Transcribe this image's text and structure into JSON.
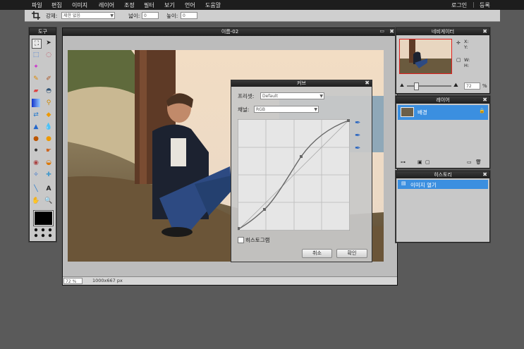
{
  "menubar": {
    "items": [
      "파일",
      "편집",
      "이미지",
      "레이어",
      "조정",
      "필터",
      "보기",
      "언어",
      "도움말"
    ],
    "login": "로그인",
    "sep": "|",
    "register": "등록"
  },
  "options": {
    "mode_label": "강제:",
    "mode_value": "제한 없음",
    "width_label": "넓이:",
    "width_value": "0",
    "height_label": "높이:",
    "height_value": "0"
  },
  "tools_panel": {
    "title": "도구"
  },
  "document": {
    "title": "이름-02",
    "zoom": "72",
    "zoom_unit": "%",
    "dimensions": "1000x667 px"
  },
  "curves": {
    "title": "커브",
    "preset_label": "프리셋:",
    "preset_value": "Default",
    "channel_label": "채널:",
    "channel_value": "RGB",
    "histogram_label": "히스토그램",
    "histogram_checked": false,
    "cancel_label": "취소",
    "ok_label": "확인"
  },
  "navigator": {
    "title": "네비게이터",
    "x_label": "X:",
    "y_label": "Y:",
    "w_label": "W:",
    "h_label": "H:",
    "zoom_value": "72",
    "zoom_unit": "%"
  },
  "layers": {
    "title": "레이어",
    "items": [
      {
        "name": "배경"
      }
    ]
  },
  "history": {
    "title": "히스토리",
    "items": [
      {
        "name": "이미지 열기"
      }
    ]
  },
  "colors": {
    "accent": "#3b8fe0",
    "panel_bg": "#c8c8c8",
    "titlebar": "#1e1e1e",
    "workspace": "#5a5a5a"
  },
  "icons": [
    "crop-icon",
    "move-icon",
    "marquee-icon",
    "lasso-icon",
    "wand-icon",
    "pencil-icon",
    "brush-icon",
    "eraser-icon",
    "fill-icon",
    "gradient-icon",
    "clone-icon",
    "color-replace-icon",
    "drawing-icon",
    "red-eye-icon",
    "sponge-icon",
    "sharpen-icon",
    "blur-icon",
    "smudge-icon",
    "dodge-icon",
    "burn-icon",
    "colorpicker-icon",
    "type-icon",
    "hand-icon",
    "zoom-icon",
    "lock-icon",
    "close-icon",
    "eyedropper-icon"
  ]
}
